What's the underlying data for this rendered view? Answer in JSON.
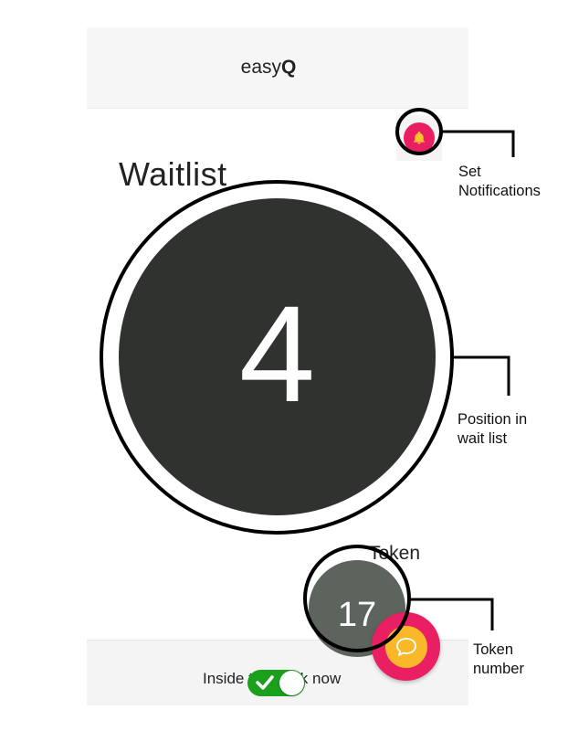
{
  "app": {
    "title_plain": "easy",
    "title_bold": "Q"
  },
  "page": {
    "title": "Waitlist"
  },
  "position": {
    "value": "4"
  },
  "token": {
    "label": "Token",
    "value": "17"
  },
  "bottom_bar": {
    "inside_label": "Inside the bank now",
    "toggle_on": true
  },
  "icons": {
    "notifications": "bell-icon",
    "chat": "chat-bubble-icon",
    "toggle_check": "checkmark-icon"
  },
  "colors": {
    "accent_pink": "#e91e63",
    "chat_inner": "#f9b72a",
    "position_circle": "#2f322f",
    "token_circle": "#5d645d",
    "toggle_on": "#1aa01a"
  },
  "annotations": {
    "notifications_line1": "Set",
    "notifications_line2": "Notifications",
    "position_line1": "Position in",
    "position_line2": "wait list",
    "token_line1": "Token",
    "token_line2": "number"
  }
}
